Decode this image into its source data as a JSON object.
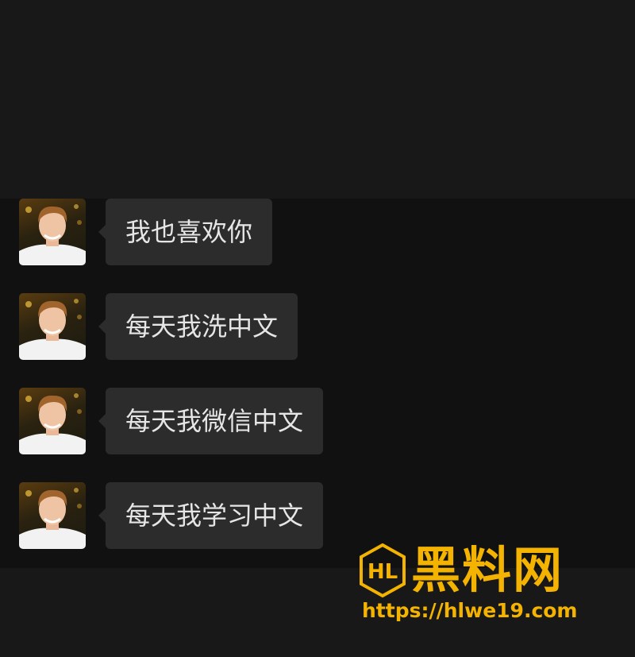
{
  "messages": [
    {
      "text": "我也喜欢你"
    },
    {
      "text": "每天我洗中文"
    },
    {
      "text": "每天我微信中文"
    },
    {
      "text": "每天我学习中文"
    }
  ],
  "watermark": {
    "logo_text": "HL",
    "title": "黑料网",
    "url": "https://hlwe19.com"
  },
  "colors": {
    "bubble": "#2c2c2c",
    "text": "#e6e6e6",
    "watermark": "#f5b301"
  }
}
